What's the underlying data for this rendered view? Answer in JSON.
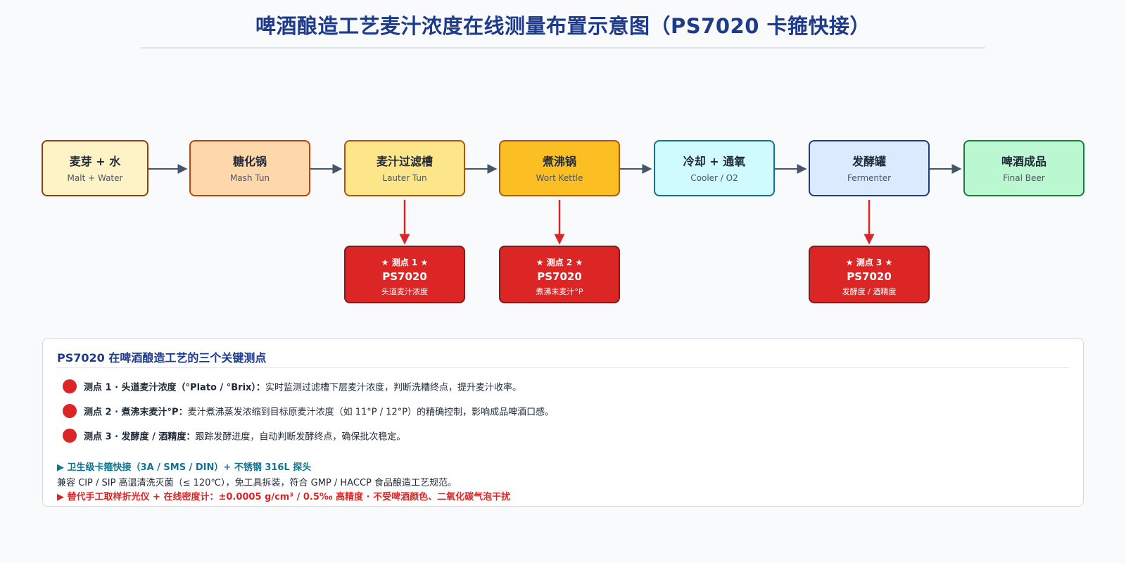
{
  "title": "啤酒酿造工艺麦汁浓度在线测量布置示意图（PS7020 卡箍快接）",
  "stages": [
    {
      "name": "麦芽 + 水",
      "sub": "Malt + Water",
      "fill": "#fef3c7",
      "border": "#92400e"
    },
    {
      "name": "糖化锅",
      "sub": "Mash Tun",
      "fill": "#fed7aa",
      "border": "#c2410c"
    },
    {
      "name": "麦汁过滤槽",
      "sub": "Lauter Tun",
      "fill": "#fde68a",
      "border": "#b45309"
    },
    {
      "name": "煮沸锅",
      "sub": "Wort Kettle",
      "fill": "#fbbf24",
      "border": "#b45309"
    },
    {
      "name": "冷却 + 通氧",
      "sub": "Cooler / O2",
      "fill": "#cffafe",
      "border": "#0e7490"
    },
    {
      "name": "发酵罐",
      "sub": "Fermenter",
      "fill": "#dbeafe",
      "border": "#1e3a8a"
    },
    {
      "name": "啤酒成品",
      "sub": "Final Beer",
      "fill": "#bbf7d0",
      "border": "#15803d"
    }
  ],
  "probes": [
    {
      "tag": "★ 测点 1 ★",
      "model": "PS7020",
      "desc": "头道麦汁浓度"
    },
    {
      "tag": "★ 测点 2 ★",
      "model": "PS7020",
      "desc": "煮沸末麦汁°P"
    },
    {
      "tag": "★ 测点 3 ★",
      "model": "PS7020",
      "desc": "发酵度 / 酒精度"
    }
  ],
  "panel": {
    "title": "PS7020 在啤酒酿造工艺的三个关键测点",
    "points": [
      {
        "label": "测点 1 · 头道麦汁浓度（°Plato / °Brix）：",
        "text": "实时监测过滤槽下层麦汁浓度，判断洗糟终点，提升麦汁收率。"
      },
      {
        "label": "测点 2 · 煮沸末麦汁°P：",
        "text": "麦汁煮沸蒸发浓缩到目标原麦汁浓度（如 11°P / 12°P）的精确控制，影响成品啤酒口感。"
      },
      {
        "label": "测点 3 · 发酵度 / 酒精度：",
        "text": "跟踪发酵进度，自动判断发酵终点，确保批次稳定。"
      }
    ],
    "footer_1": "▶ 卫生级卡箍快接（3A / SMS / DIN）+ 不锈钢 316L 探头",
    "footer_2": "兼容 CIP / SIP 高温清洗灭菌（≤ 120℃），免工具拆装，符合 GMP / HACCP 食品酿造工艺规范。",
    "footer_3": "▶ 替代手工取样折光仪 + 在线密度计：±0.0005 g/cm³ / 0.5‰ 高精度 · 不受啤酒颜色、二氧化碳气泡干扰"
  },
  "colors": {
    "flow_arrow": "#475569",
    "probe_arrow": "#dc2626",
    "probe_fill": "#dc2626",
    "title": "#1e3a8a"
  }
}
